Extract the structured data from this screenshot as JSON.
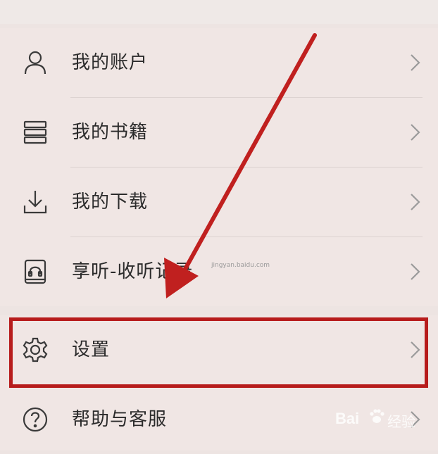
{
  "menu": {
    "items": [
      {
        "label": "我的账户",
        "icon": "user-icon"
      },
      {
        "label": "我的书籍",
        "icon": "books-icon"
      },
      {
        "label": "我的下载",
        "icon": "download-icon"
      },
      {
        "label": "享听-收听记录",
        "icon": "headphones-book-icon"
      },
      {
        "label": "设置",
        "icon": "gear-icon"
      },
      {
        "label": "帮助与客服",
        "icon": "help-icon"
      }
    ]
  },
  "annotation": {
    "highlight_color": "#b71c1c",
    "arrow_color": "#c0201f",
    "target": "设置"
  },
  "watermark": {
    "brand": "Bai",
    "text": "经验",
    "url": "jingyan.baidu.com"
  },
  "colors": {
    "background": "#ede4e2",
    "text": "#2b2b2b",
    "icon": "#3a3a3a",
    "chevron": "#9b9b9b"
  }
}
